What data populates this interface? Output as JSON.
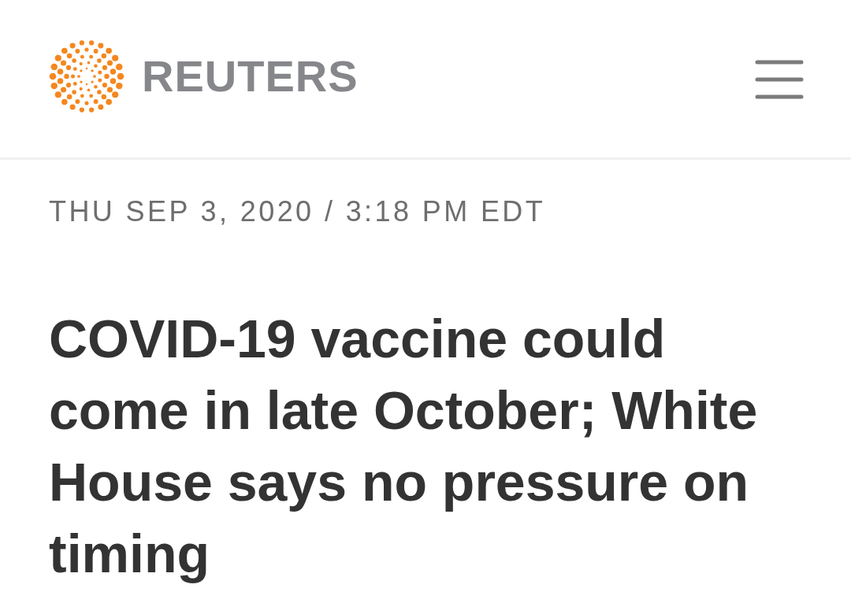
{
  "header": {
    "brand": "REUTERS"
  },
  "article": {
    "dateline": "THU SEP 3, 2020 / 3:18 PM EDT",
    "headline": "COVID-19 vaccine could come in late October; White House says no pressure on timing"
  }
}
